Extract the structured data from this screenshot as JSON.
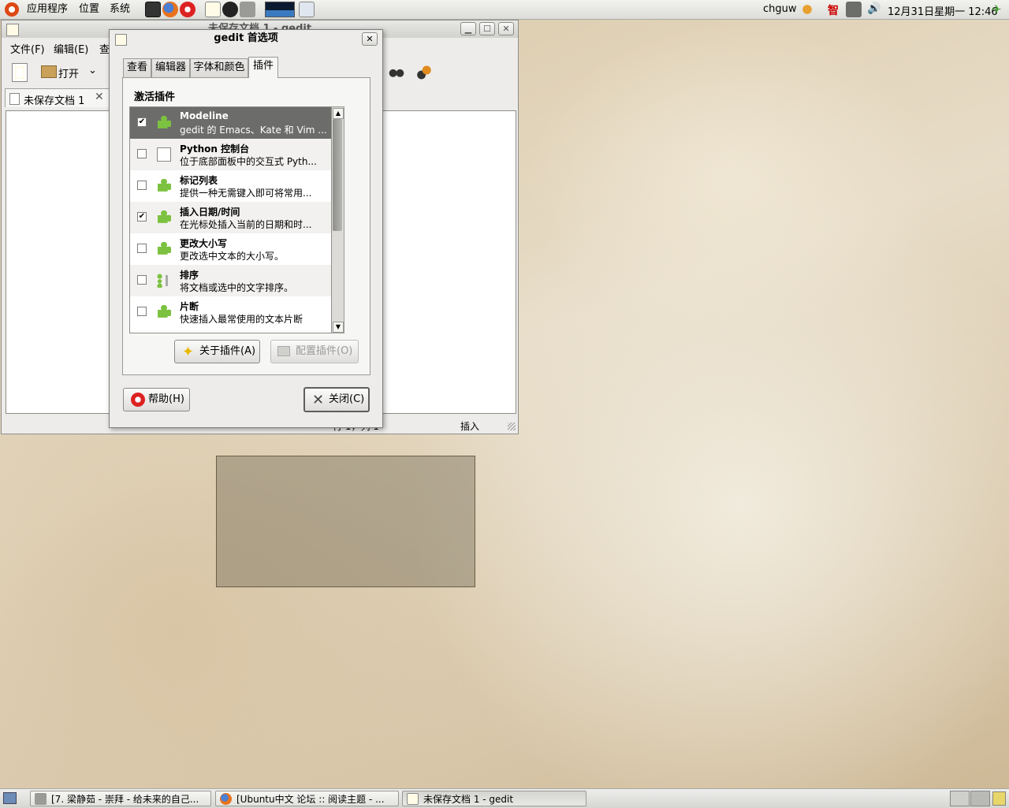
{
  "top_panel": {
    "menus": [
      "应用程序",
      "位置",
      "系统"
    ],
    "user": "chguw",
    "clock": "12月31日星期一 12:46"
  },
  "gedit_window": {
    "title": "未保存文档 1 - gedit",
    "menus": [
      "文件(F)",
      "编辑(E)",
      "查"
    ],
    "toolbar": {
      "open_label": "打开"
    },
    "doc_tab": "未保存文档 1",
    "status_position": "行 1，列 1",
    "status_mode": "插入"
  },
  "dialog": {
    "title": "gedit 首选项",
    "tabs": [
      "查看",
      "编辑器",
      "字体和颜色",
      "插件"
    ],
    "section_title": "激活插件",
    "plugins": [
      {
        "name": "Modeline",
        "desc": "gedit 的 Emacs、Kate 和 Vim ...",
        "checked": true
      },
      {
        "name": "Python 控制台",
        "desc": "位于底部面板中的交互式 Pyth...",
        "checked": false
      },
      {
        "name": "标记列表",
        "desc": "提供一种无需键入即可将常用...",
        "checked": false
      },
      {
        "name": "插入日期/时间",
        "desc": "在光标处插入当前的日期和时...",
        "checked": true
      },
      {
        "name": "更改大小写",
        "desc": "更改选中文本的大小写。",
        "checked": false
      },
      {
        "name": "排序",
        "desc": "将文档或选中的文字排序。",
        "checked": false
      },
      {
        "name": "片断",
        "desc": "快速插入最常使用的文本片断",
        "checked": false
      }
    ],
    "about_button": "关于插件(A)",
    "config_button": "配置插件(O)",
    "help_button": "帮助(H)",
    "close_button": "关闭(C)"
  },
  "taskbar": {
    "items": [
      "[7. 梁静茹 - 崇拜 - 给未来的自己...",
      "[Ubuntu中文 论坛 :: 阅读主题 - ...",
      "未保存文档 1 - gedit"
    ]
  }
}
